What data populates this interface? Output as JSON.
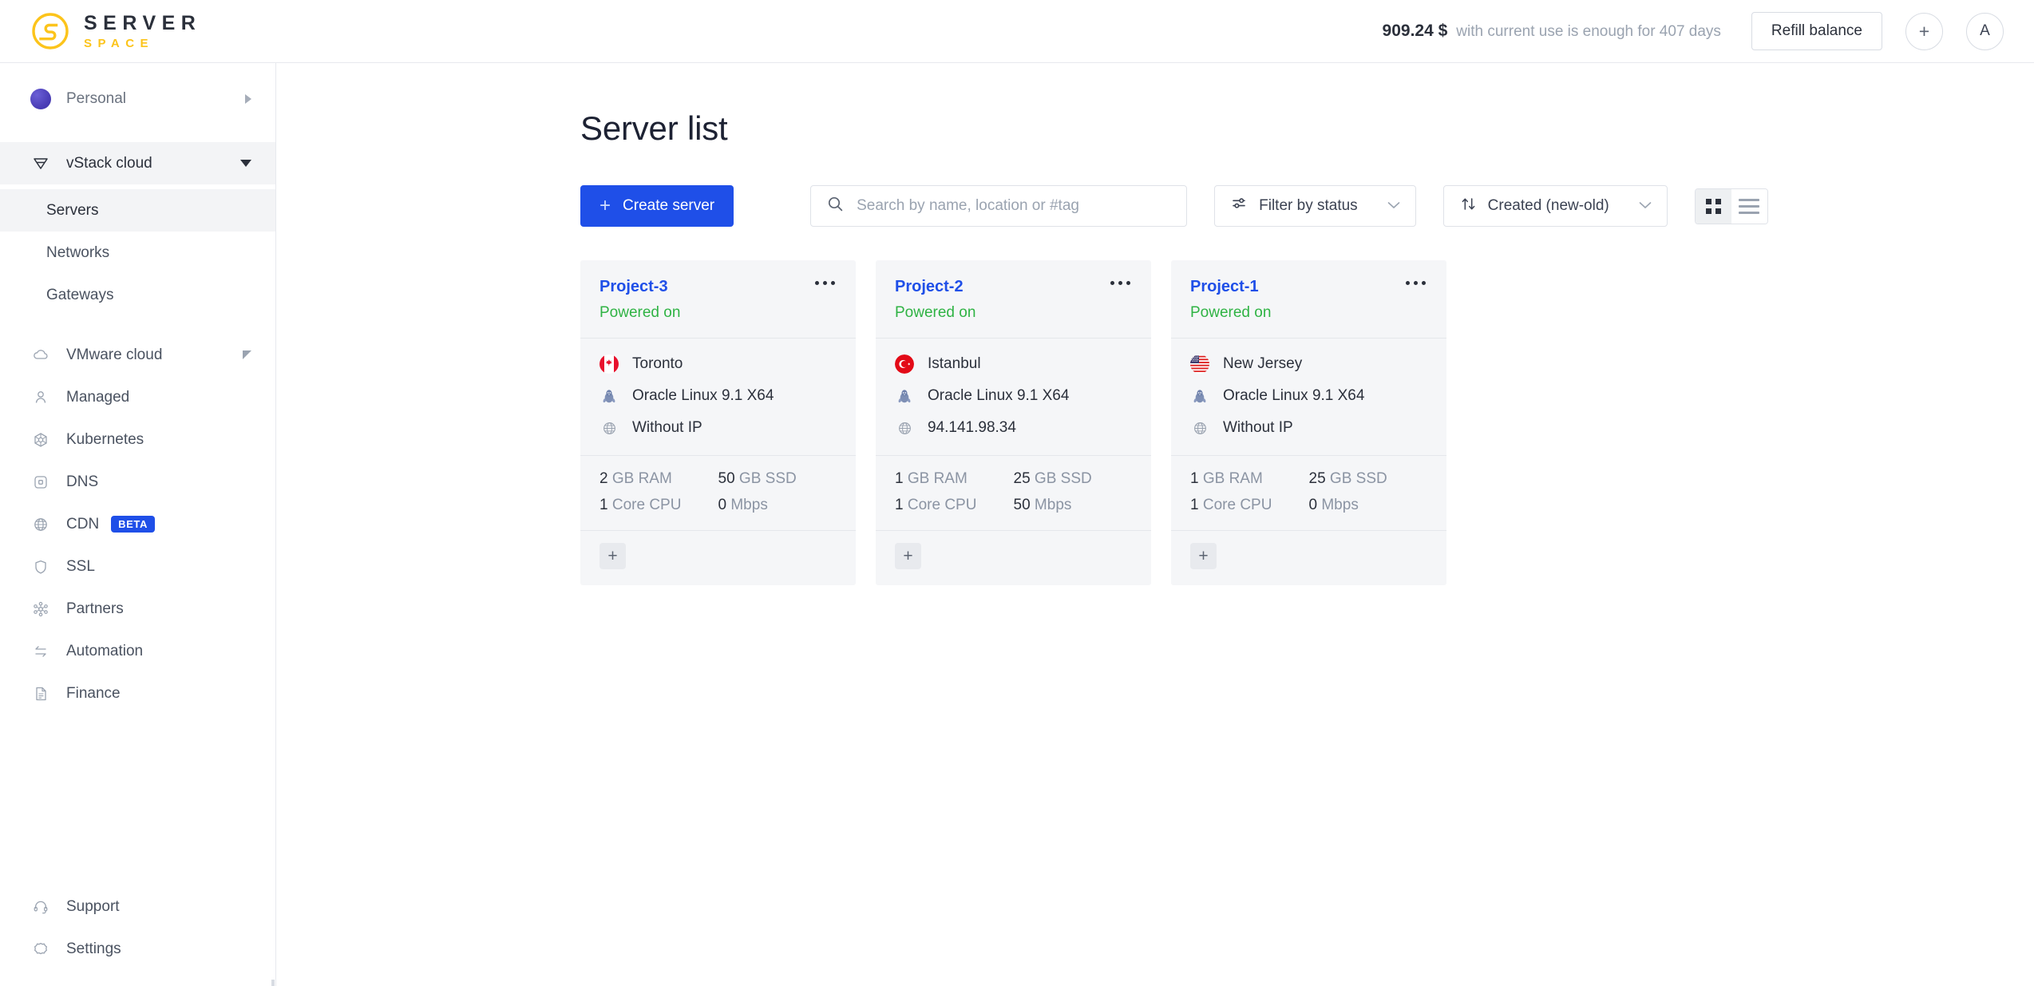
{
  "brand": {
    "logo_primary": "SERVER",
    "logo_secondary": "SPACE",
    "logo_color": "#fcc41b",
    "accent_color": "#1f4fe8"
  },
  "header": {
    "balance_amount": "909.24 $",
    "balance_note": "with current use is enough for 407 days",
    "refill_label": "Refill balance",
    "add_label": "+",
    "avatar_label": "A"
  },
  "sidebar": {
    "account": {
      "label": "Personal",
      "icon": "account-avatar"
    },
    "items": [
      {
        "label": "vStack cloud",
        "icon": "vstack-icon",
        "state": "expanded"
      },
      {
        "label": "Servers",
        "icon": "",
        "state": "selected"
      },
      {
        "label": "Networks",
        "icon": "",
        "state": ""
      },
      {
        "label": "Gateways",
        "icon": "",
        "state": ""
      },
      {
        "label": "VMware cloud",
        "icon": "cloud-icon",
        "state": "collapsed"
      },
      {
        "label": "Managed",
        "icon": "person-icon",
        "state": ""
      },
      {
        "label": "Kubernetes",
        "icon": "kubernetes-icon",
        "state": ""
      },
      {
        "label": "DNS",
        "icon": "dns-icon",
        "state": ""
      },
      {
        "label": "CDN",
        "icon": "globe-icon",
        "state": "",
        "badge": "BETA"
      },
      {
        "label": "SSL",
        "icon": "shield-icon",
        "state": ""
      },
      {
        "label": "Partners",
        "icon": "partners-icon",
        "state": ""
      },
      {
        "label": "Automation",
        "icon": "automation-icon",
        "state": ""
      },
      {
        "label": "Finance",
        "icon": "document-icon",
        "state": ""
      }
    ],
    "bottom_items": [
      {
        "label": "Support",
        "icon": "headset-icon"
      },
      {
        "label": "Settings",
        "icon": "gear-icon"
      }
    ]
  },
  "main": {
    "title": "Server list",
    "create_label": "Create server",
    "search_placeholder": "Search by name, location or #tag",
    "search_value": "",
    "filter_label": "Filter by status",
    "sort_label": "Created (new-old)",
    "view_grid": "grid-view",
    "view_list": "list-view",
    "active_view": "grid"
  },
  "servers": [
    {
      "name": "Project-3",
      "status": "Powered on",
      "status_color": "#2fb344",
      "location": "Toronto",
      "flag": "ca",
      "os": "Oracle Linux 9.1 X64",
      "ip": "Without IP",
      "ram_value": "2",
      "ram_unit": "GB RAM",
      "disk_value": "50",
      "disk_unit": "GB SSD",
      "cpu_value": "1",
      "cpu_unit": "Core CPU",
      "net_value": "0",
      "net_unit": "Mbps",
      "add_label": "+"
    },
    {
      "name": "Project-2",
      "status": "Powered on",
      "status_color": "#2fb344",
      "location": "Istanbul",
      "flag": "tr",
      "os": "Oracle Linux 9.1 X64",
      "ip": "94.141.98.34",
      "ram_value": "1",
      "ram_unit": "GB RAM",
      "disk_value": "25",
      "disk_unit": "GB SSD",
      "cpu_value": "1",
      "cpu_unit": "Core CPU",
      "net_value": "50",
      "net_unit": "Mbps",
      "add_label": "+"
    },
    {
      "name": "Project-1",
      "status": "Powered on",
      "status_color": "#2fb344",
      "location": "New Jersey",
      "flag": "us",
      "os": "Oracle Linux 9.1 X64",
      "ip": "Without IP",
      "ram_value": "1",
      "ram_unit": "GB RAM",
      "disk_value": "25",
      "disk_unit": "GB SSD",
      "cpu_value": "1",
      "cpu_unit": "Core CPU",
      "net_value": "0",
      "net_unit": "Mbps",
      "add_label": "+"
    }
  ]
}
